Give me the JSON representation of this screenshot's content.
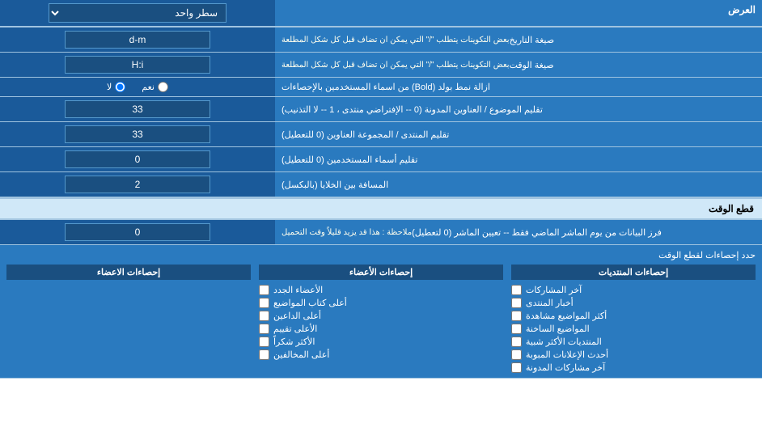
{
  "header": {
    "label": "العرض",
    "control_label": "سطر واحد"
  },
  "rows": [
    {
      "id": "date-format",
      "label": "صيغة التاريخ",
      "sublabel": "بعض التكوينات يتطلب \"/\" التي يمكن ان تضاف قبل كل شكل المطلعة",
      "value": "d-m",
      "type": "input"
    },
    {
      "id": "time-format",
      "label": "صيغة الوقت",
      "sublabel": "بعض التكوينات يتطلب \"/\" التي يمكن ان تضاف قبل كل شكل المطلعة",
      "value": "H:i",
      "type": "input"
    },
    {
      "id": "bold-remove",
      "label": "ازالة نمط بولد (Bold) من اسماء المستخدمين بالإحصاءات",
      "value_yes": "نعم",
      "value_no": "لا",
      "type": "radio",
      "selected": "no"
    },
    {
      "id": "topic-subject",
      "label": "تقليم الموضوع / العناوين المدونة (0 -- الإفتراضي منتدى ، 1 -- لا التذنيب)",
      "value": "33",
      "type": "input"
    },
    {
      "id": "forum-group",
      "label": "تقليم المنتدى / المجموعة العناوين (0 للتعطيل)",
      "value": "33",
      "type": "input"
    },
    {
      "id": "username-trim",
      "label": "تقليم أسماء المستخدمين (0 للتعطيل)",
      "value": "0",
      "type": "input"
    },
    {
      "id": "cell-space",
      "label": "المسافة بين الخلايا (بالبكسل)",
      "value": "2",
      "type": "input"
    }
  ],
  "section_cutoff": {
    "title": "قطع الوقت",
    "row": {
      "id": "cutoff-days",
      "label": "فرز البيانات من يوم الماشر الماضي فقط -- تعيين الماشر (0 لتعطيل)",
      "note": "ملاحظة : هذا قد يزيد قليلاً وقت التحميل",
      "value": "0",
      "type": "input"
    }
  },
  "bottom": {
    "header": "حدد إحصاءات لقطع الوقت",
    "col1": {
      "title": "إحصاءات الأعضاء",
      "items": [
        "الأعضاء الجدد",
        "أعلى كتاب المواضيع",
        "أعلى الداعين",
        "الأعلى تقييم",
        "الأكثر شكراً",
        "أعلى المخالفين"
      ]
    },
    "col2": {
      "title": "إحصاءات المنتديات",
      "items": [
        "آخر المشاركات",
        "أخبار المنتدى",
        "أكثر المواضيع مشاهدة",
        "المواضيع الساخنة",
        "المنتديات الأكثر شبية",
        "أحدث الإعلانات المبوبة",
        "آخر مشاركات المدونة"
      ]
    },
    "col3": {
      "title": "إحصاءات الاعضاء",
      "items": []
    }
  },
  "colors": {
    "blue_dark": "#1a4f80",
    "blue_mid": "#1a5a9a",
    "blue_header": "#2a7abf",
    "accent": "#d0e8f8"
  }
}
